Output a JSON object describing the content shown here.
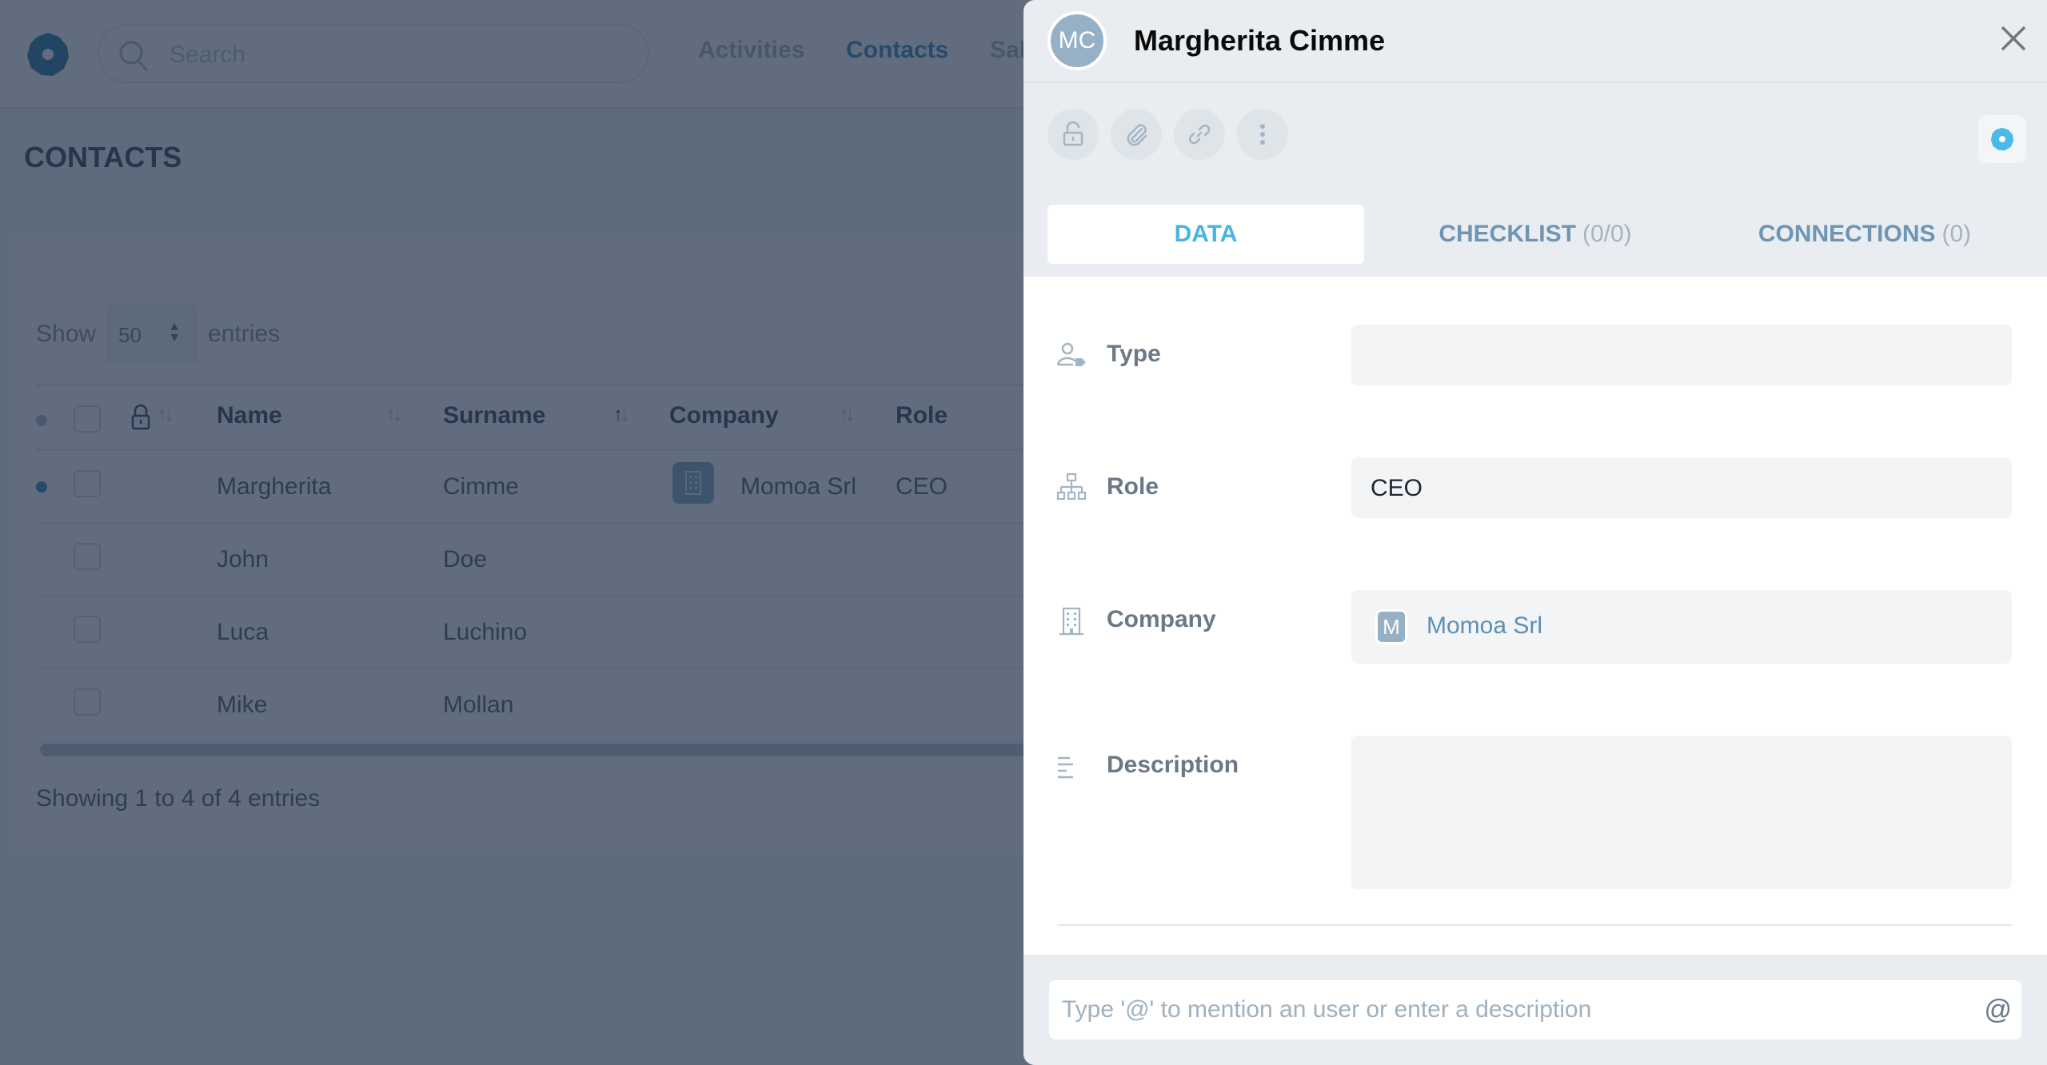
{
  "app": {
    "search_placeholder": "Search",
    "nav": [
      {
        "label": "Activities",
        "active": false
      },
      {
        "label": "Contacts",
        "active": true
      },
      {
        "label": "Sales",
        "active": false
      }
    ],
    "page_title": "CONTACTS"
  },
  "table": {
    "show_label": "Show",
    "entries_label": "entries",
    "page_size": "50",
    "columns": [
      "Name",
      "Surname",
      "Company",
      "Role"
    ],
    "rows": [
      {
        "name": "Margherita",
        "surname": "Cimme",
        "company": "Momoa Srl",
        "role": "CEO",
        "highlighted": true
      },
      {
        "name": "John",
        "surname": "Doe",
        "company": "",
        "role": "",
        "highlighted": false
      },
      {
        "name": "Luca",
        "surname": "Luchino",
        "company": "",
        "role": "",
        "highlighted": false
      },
      {
        "name": "Mike",
        "surname": "Mollan",
        "company": "",
        "role": "",
        "highlighted": false
      }
    ],
    "footer": "Showing 1 to 4 of 4 entries"
  },
  "panel": {
    "avatar_initials": "MC",
    "title": "Margherita Cimme",
    "tools": [
      "lock-open-icon",
      "paperclip-icon",
      "link-icon",
      "more-vertical-icon"
    ],
    "tabs": [
      {
        "label": "DATA",
        "count": "",
        "active": true
      },
      {
        "label": "CHECKLIST",
        "count": "(0/0)",
        "active": false
      },
      {
        "label": "CONNECTIONS",
        "count": "(0)",
        "active": false
      }
    ],
    "fields": {
      "type": {
        "label": "Type",
        "value": ""
      },
      "role": {
        "label": "Role",
        "value": "CEO"
      },
      "company": {
        "label": "Company",
        "badge": "M",
        "value": "Momoa Srl"
      },
      "description": {
        "label": "Description",
        "value": ""
      }
    },
    "comment_placeholder": "Type '@' to mention an user or enter a description",
    "mention_symbol": "@"
  },
  "colors": {
    "accent": "#4bb3e3",
    "brand_dark": "#1a6f9c",
    "tab_inactive": "#6e95b1",
    "avatar_bg": "#96b1c6"
  }
}
